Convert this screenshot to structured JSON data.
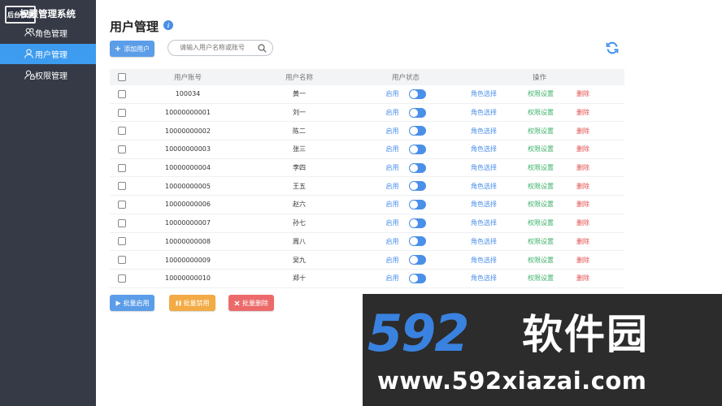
{
  "sidebar": {
    "brand": "权限管理系统",
    "logo_text": "后台管理",
    "items": [
      {
        "label": "角色管理",
        "icon": "users-icon",
        "active": false
      },
      {
        "label": "用户管理",
        "icon": "user-icon",
        "active": true
      },
      {
        "label": "权限管理",
        "icon": "user-lock-icon",
        "active": false
      }
    ]
  },
  "header": {
    "title": "用户管理",
    "info_icon": "i"
  },
  "toolbar": {
    "add_label": "添加用户",
    "add_icon": "+",
    "search_placeholder": "请输入用户名称或账号",
    "refresh_icon": "refresh-icon"
  },
  "table": {
    "columns": [
      "用户账号",
      "用户名称",
      "用户状态",
      "操作"
    ],
    "rows": [
      {
        "account": "100034",
        "name": "黄一",
        "status": "启用",
        "on": true
      },
      {
        "account": "10000000001",
        "name": "刘一",
        "status": "启用",
        "on": true
      },
      {
        "account": "10000000002",
        "name": "陈二",
        "status": "启用",
        "on": true
      },
      {
        "account": "10000000003",
        "name": "张三",
        "status": "启用",
        "on": true
      },
      {
        "account": "10000000004",
        "name": "李四",
        "status": "启用",
        "on": true
      },
      {
        "account": "10000000005",
        "name": "王五",
        "status": "启用",
        "on": true
      },
      {
        "account": "10000000006",
        "name": "赵六",
        "status": "启用",
        "on": true
      },
      {
        "account": "10000000007",
        "name": "孙七",
        "status": "启用",
        "on": true
      },
      {
        "account": "10000000008",
        "name": "周八",
        "status": "启用",
        "on": true
      },
      {
        "account": "10000000009",
        "name": "吴九",
        "status": "启用",
        "on": true
      },
      {
        "account": "10000000010",
        "name": "郑十",
        "status": "启用",
        "on": true
      }
    ],
    "ops": {
      "role": "角色选择",
      "perm": "权限设置",
      "del": "删除"
    }
  },
  "bulk": {
    "enable_label": "批量启用",
    "disable_label": "批量禁用",
    "delete_label": "批量删除"
  },
  "watermark": {
    "logo": "592",
    "cn": "软件园",
    "url": "www.592xiazai.com"
  },
  "colors": {
    "sidebar_bg": "#363a46",
    "accent": "#3d9bf0",
    "green": "#3db16a",
    "red": "#e24b4b",
    "orange": "#f2ab45"
  }
}
